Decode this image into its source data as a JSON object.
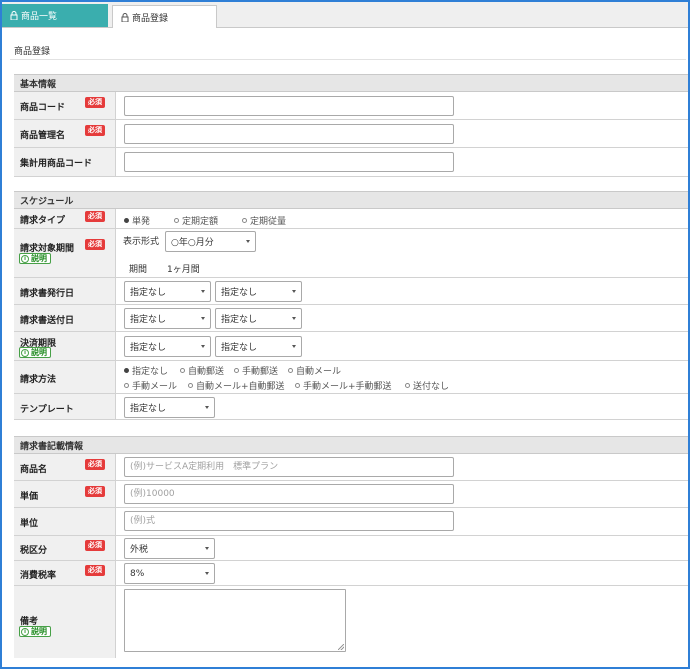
{
  "tabs": [
    {
      "label": "商品一覧",
      "active": true
    },
    {
      "label": "商品登録",
      "active": false
    }
  ],
  "page_title": "商品登録",
  "badges": {
    "required": "必須",
    "help": "説明"
  },
  "basic": {
    "title": "基本情報",
    "product_code": {
      "label": "商品コード",
      "value": ""
    },
    "product_name": {
      "label": "商品管理名",
      "value": ""
    },
    "aggregate_code": {
      "label": "集計用商品コード",
      "value": ""
    }
  },
  "schedule": {
    "title": "スケジュール",
    "billing_type": {
      "label": "請求タイプ",
      "options": [
        "単発",
        "定期定額",
        "定期従量"
      ],
      "selected": "単発"
    },
    "billing_period": {
      "label": "請求対象期間",
      "display_format_label": "表示形式",
      "display_format_value": "○年○月分",
      "period_label": "期間",
      "period_value": "1ヶ月間"
    },
    "issue_date": {
      "label": "請求書発行日",
      "select1": "指定なし",
      "select2": "指定なし"
    },
    "send_date": {
      "label": "請求書送付日",
      "select1": "指定なし",
      "select2": "指定なし"
    },
    "payment_due": {
      "label": "決済期限",
      "select1": "指定なし",
      "select2": "指定なし"
    },
    "billing_method": {
      "label": "請求方法",
      "options_row1": [
        "指定なし",
        "自動郵送",
        "手動郵送",
        "自動メール"
      ],
      "options_row2": [
        "手動メール",
        "自動メール+自動郵送",
        "手動メール+手動郵送",
        "送付なし"
      ],
      "selected": "指定なし"
    },
    "template": {
      "label": "テンプレート",
      "value": "指定なし"
    }
  },
  "invoice": {
    "title": "請求書記載情報",
    "item_name": {
      "label": "商品名",
      "placeholder": "(例)サービスA定期利用　標準プラン"
    },
    "unit_price": {
      "label": "単価",
      "placeholder": "(例)10000"
    },
    "unit": {
      "label": "単位",
      "placeholder": "(例)式"
    },
    "tax_type": {
      "label": "税区分",
      "value": "外税"
    },
    "tax_rate": {
      "label": "消費税率",
      "value": "8%"
    },
    "remarks": {
      "label": "備考",
      "value": ""
    }
  }
}
